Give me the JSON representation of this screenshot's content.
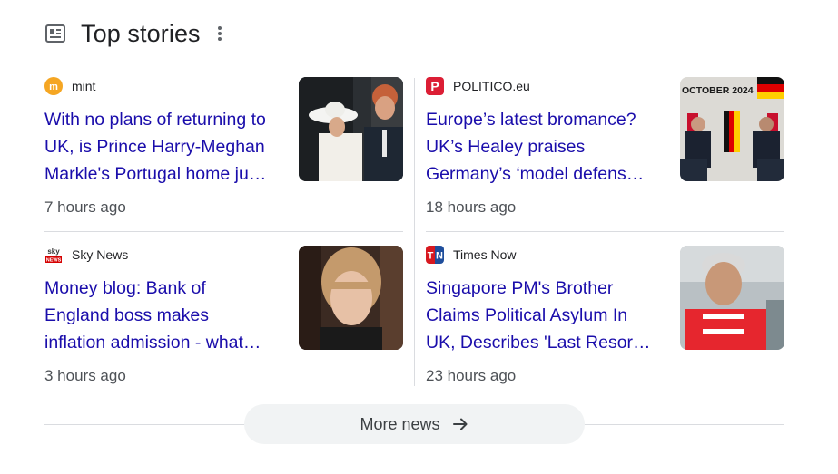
{
  "section": {
    "title": "Top stories"
  },
  "stories": [
    {
      "source": "mint",
      "source_logo": "mint-logo-icon",
      "headline_lines": [
        "With no plans of returning to",
        "UK, is Prince Harry-Meghan",
        "Markle's Portugal home ju…"
      ],
      "time": "7 hours ago",
      "thumbnail": "couple-in-hats-photo"
    },
    {
      "source": "POLITICO.eu",
      "source_logo": "politico-logo-icon",
      "headline_lines": [
        "Europe’s latest bromance?",
        "UK’s Healey praises",
        "Germany’s ‘model defens…"
      ],
      "time": "18 hours ago",
      "thumbnail": "press-conference-flags-photo",
      "thumbnail_text": "OCTOBER 2024"
    },
    {
      "source": "Sky News",
      "source_logo": "sky-news-logo-icon",
      "headline_lines": [
        "Money blog: Bank of",
        "England boss makes",
        "inflation admission - what…"
      ],
      "time": "3 hours ago",
      "thumbnail": "woman-portrait-photo"
    },
    {
      "source": "Times Now",
      "source_logo": "times-now-logo-icon",
      "headline_lines": [
        "Singapore PM's Brother",
        "Claims Political Asylum In",
        "UK, Describes 'Last Resor…"
      ],
      "time": "23 hours ago",
      "thumbnail": "man-in-red-shirt-photo"
    }
  ],
  "more_button": {
    "label": "More news"
  },
  "colors": {
    "headline": "#1a0dab",
    "meta": "#4d5156",
    "divider": "#dadce0",
    "button_bg": "#f1f3f4"
  }
}
